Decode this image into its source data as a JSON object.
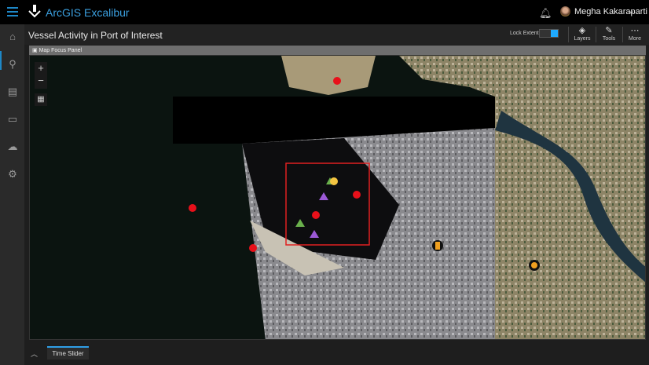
{
  "app": {
    "title": "ArcGIS Excalibur",
    "user": "Megha Kakaraparti"
  },
  "page": {
    "title": "Vessel Activity in Port of Interest",
    "lock_extents": "Lock Extents",
    "lock_extents_on": true
  },
  "tools": [
    {
      "label": "Layers",
      "icon": "layers-icon"
    },
    {
      "label": "Tools",
      "icon": "pencil-icon"
    },
    {
      "label": "More",
      "icon": "more-icon"
    }
  ],
  "panel": {
    "title": "Map Focus Panel"
  },
  "map": {
    "zoom_in": "+",
    "zoom_out": "−",
    "colors": {
      "red_marker": "#e8101a",
      "green_marker": "#6ab04c",
      "purple_marker": "#9b59d6",
      "yellow_marker": "#f4c542",
      "focus_box": "#e02020",
      "orange_marker": "#f0a020"
    }
  },
  "rail": [
    "home-icon",
    "search-icon",
    "documents-icon",
    "folder-icon",
    "upload-icon",
    "settings-icon"
  ],
  "bottom": {
    "time_slider": "Time Slider"
  }
}
